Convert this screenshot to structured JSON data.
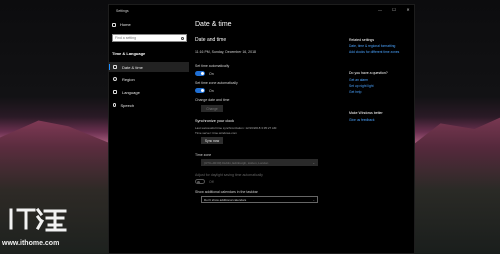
{
  "window": {
    "title": "Settings",
    "controls": [
      "—",
      "☐",
      "✕"
    ]
  },
  "nav": {
    "home": "Home",
    "search_placeholder": "Find a setting",
    "section": "Time & Language",
    "items": [
      {
        "label": "Date & time",
        "icon": "calendar-icon",
        "active": true
      },
      {
        "label": "Region",
        "icon": "globe-icon",
        "active": false
      },
      {
        "label": "Language",
        "icon": "language-icon",
        "active": false
      },
      {
        "label": "Speech",
        "icon": "microphone-icon",
        "active": false
      }
    ]
  },
  "main": {
    "page_title": "Date & time",
    "section_title": "Date and time",
    "current_time": "11:16 PM, Sunday, December 16, 2018",
    "set_time_auto": {
      "label": "Set time automatically",
      "state": "On"
    },
    "set_timezone_auto": {
      "label": "Set time zone automatically",
      "state": "On"
    },
    "change_date": {
      "label": "Change date and time",
      "button": "Change"
    },
    "sync": {
      "heading": "Synchronize your clock",
      "last_sync": "Last successful time synchronization: 12/16/2018 3:35:27 AM",
      "server": "Time server: time.windows.com",
      "button": "Sync now"
    },
    "timezone": {
      "label": "Time zone",
      "value": "(UTC+00:00) Dublin, Edinburgh, Lisbon, London"
    },
    "dst": {
      "label": "Adjust for daylight saving time automatically",
      "state": "Off"
    },
    "calendars": {
      "label": "Show additional calendars in the taskbar",
      "value": "Don't show additional calendars"
    }
  },
  "right": {
    "related_head": "Related settings",
    "related_links": [
      "Date, time & regional formatting",
      "Add clocks for different time zones"
    ],
    "question_head": "Do you have a question?",
    "question_links": [
      "Get an alarm",
      "Set up night light",
      "Get help"
    ],
    "better_head": "Make Windows better",
    "better_links": [
      "Give us feedback"
    ]
  },
  "watermark": {
    "url": "www.ithome.com",
    "logo": "IT之家"
  },
  "colors": {
    "accent": "#1f6fd4",
    "link": "#4aa3ff",
    "window_bg": "#000000"
  }
}
